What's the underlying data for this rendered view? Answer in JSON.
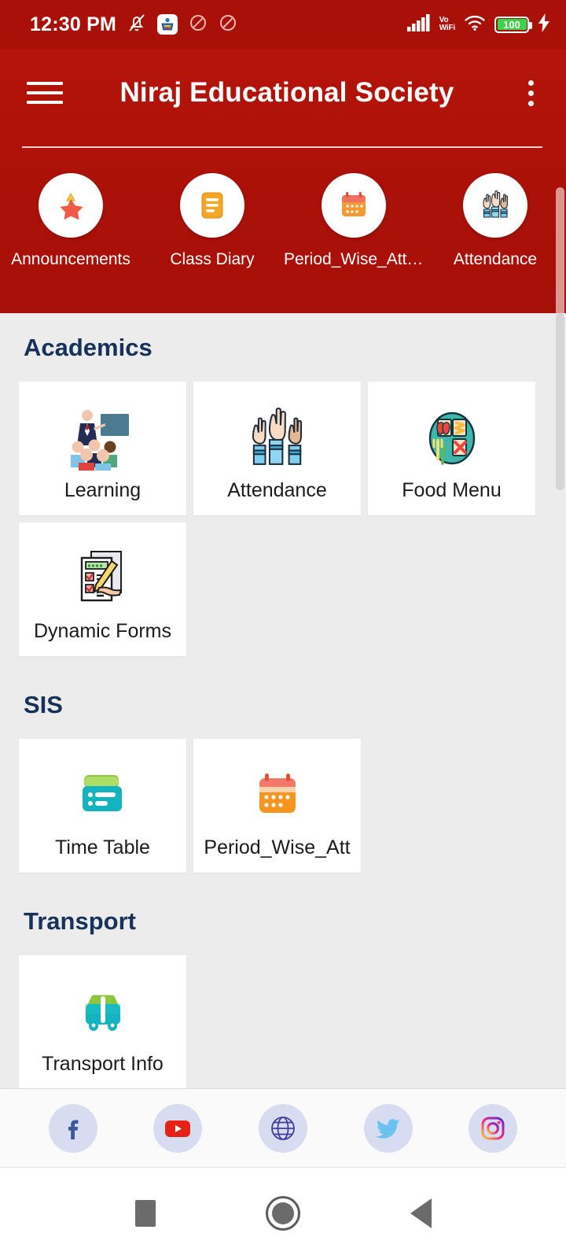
{
  "status_bar": {
    "time": "12:30 PM",
    "left_icons": [
      "bell-muted-icon",
      "app-emblem-icon",
      "dnd-icon",
      "dnd-icon"
    ],
    "signal_icon": "cellular-signal-icon",
    "vowifi_line1": "Vo",
    "vowifi_line2": "WiFi",
    "wifi_icon": "wifi-icon",
    "battery_level": "100",
    "charging_icon": "charging-bolt-icon",
    "battery_fill_color": "#3fd14a"
  },
  "app_bar": {
    "menu_icon": "hamburger-menu-icon",
    "title": "Niraj Educational Society",
    "overflow_icon": "kebab-menu-icon",
    "brand_color": "#b01309"
  },
  "shortcuts": {
    "items": [
      {
        "label": "Announcements",
        "icon": "announcement-star-icon"
      },
      {
        "label": "Class Diary",
        "icon": "class-diary-icon"
      },
      {
        "label": "Period_Wise_Atte…",
        "icon": "calendar-icon"
      },
      {
        "label": "Attendance",
        "icon": "raised-hands-icon"
      }
    ],
    "pager_dots": 2,
    "active_dot_index": 1
  },
  "sections": [
    {
      "title": "Academics",
      "cards": [
        {
          "label": "Learning",
          "icon": "teacher-classroom-icon"
        },
        {
          "label": "Attendance",
          "icon": "raised-hands-icon"
        },
        {
          "label": "Food Menu",
          "icon": "food-tray-icon"
        },
        {
          "label": "Dynamic Forms",
          "icon": "form-checklist-icon"
        }
      ]
    },
    {
      "title": "SIS",
      "cards": [
        {
          "label": "Time Table",
          "icon": "timetable-card-icon"
        },
        {
          "label": "Period_Wise_Att",
          "icon": "calendar-icon"
        }
      ]
    },
    {
      "title": "Transport",
      "cards": [
        {
          "label": "Transport Info",
          "icon": "bus-info-icon"
        }
      ]
    }
  ],
  "social_bar": {
    "items": [
      {
        "name": "facebook",
        "icon": "facebook-icon"
      },
      {
        "name": "youtube",
        "icon": "youtube-icon"
      },
      {
        "name": "website",
        "icon": "globe-icon"
      },
      {
        "name": "twitter",
        "icon": "twitter-icon"
      },
      {
        "name": "instagram",
        "icon": "instagram-icon"
      }
    ]
  },
  "nav_bar": {
    "recent_icon": "recent-apps-icon",
    "home_icon": "home-icon",
    "back_icon": "back-icon"
  },
  "section_heading_color": "#17325a"
}
